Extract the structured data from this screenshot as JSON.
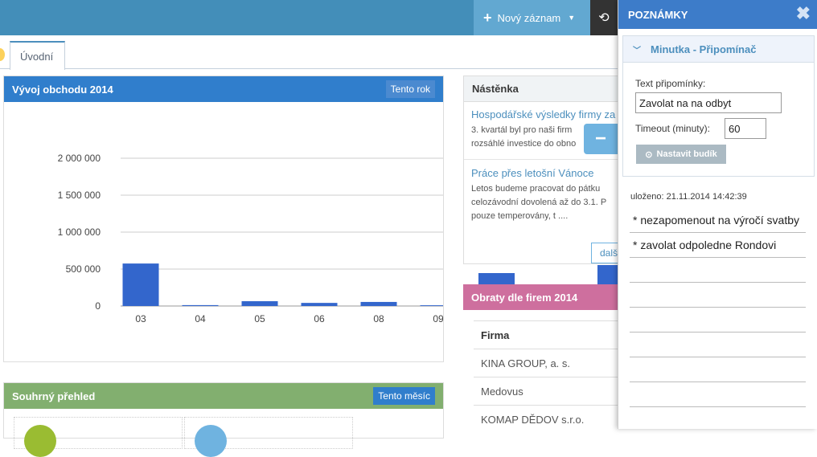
{
  "topbar": {
    "new_record_label": "Nový záznam"
  },
  "tabs": [
    {
      "label": "Úvodní"
    }
  ],
  "chart_widget": {
    "title": "Vývoj obchodu 2014",
    "period_button": "Tento rok"
  },
  "chart_data": {
    "type": "bar",
    "categories": [
      "03",
      "04",
      "05",
      "06",
      "08",
      "09"
    ],
    "values": [
      575000,
      12000,
      65000,
      42000,
      55000,
      10000
    ],
    "ylim": [
      0,
      2000000
    ],
    "y_ticks": [
      "0",
      "500 000",
      "1 000 000",
      "1 500 000",
      "2 000 000"
    ],
    "grid": true,
    "bar_color": "#3366cc"
  },
  "summary_widget": {
    "title": "Souhrný přehled",
    "period_button": "Tento měsíc"
  },
  "board_widget": {
    "title": "Nástěnka",
    "news": [
      {
        "title": "Hospodářské výsledky firmy za",
        "body": "3. kvartál byl pro naši firm rozsáhlé investice do obno"
      },
      {
        "title": "Práce přes letošní Vánoce",
        "body": "Letos budeme pracovat do pátku celozávodní dovolená až do 3.1. P pouze temperovány, t ...."
      }
    ],
    "more_button": "další"
  },
  "turnover_widget": {
    "title": "Obraty dle firem 2014",
    "header": "Firma",
    "rows": [
      "KINA GROUP, a. s.",
      "Medovus",
      "KOMAP DĚDOV s.r.o."
    ]
  },
  "notes_panel": {
    "title": "POZNÁMKY",
    "reminder_title": "Minutka - Připomínač",
    "text_label": "Text připomínky:",
    "text_value": "Zavolat na na odbyt",
    "timeout_label": "Timeout (minuty):",
    "timeout_value": "60",
    "alarm_button": "Nastavit budík",
    "saved_text": "uloženo: 21.11.2014 14:42:39",
    "notes": [
      "* nezapomenout na výročí svatby",
      "* zavolat odpoledne Rondovi",
      "",
      "",
      "",
      "",
      "",
      ""
    ]
  },
  "colors": {
    "topbar": "#438eb9",
    "chart_header": "#307ecc",
    "summary_header": "#82af6f",
    "turnover_header": "#ce6f9e",
    "notes_header": "#3d7cc9"
  }
}
